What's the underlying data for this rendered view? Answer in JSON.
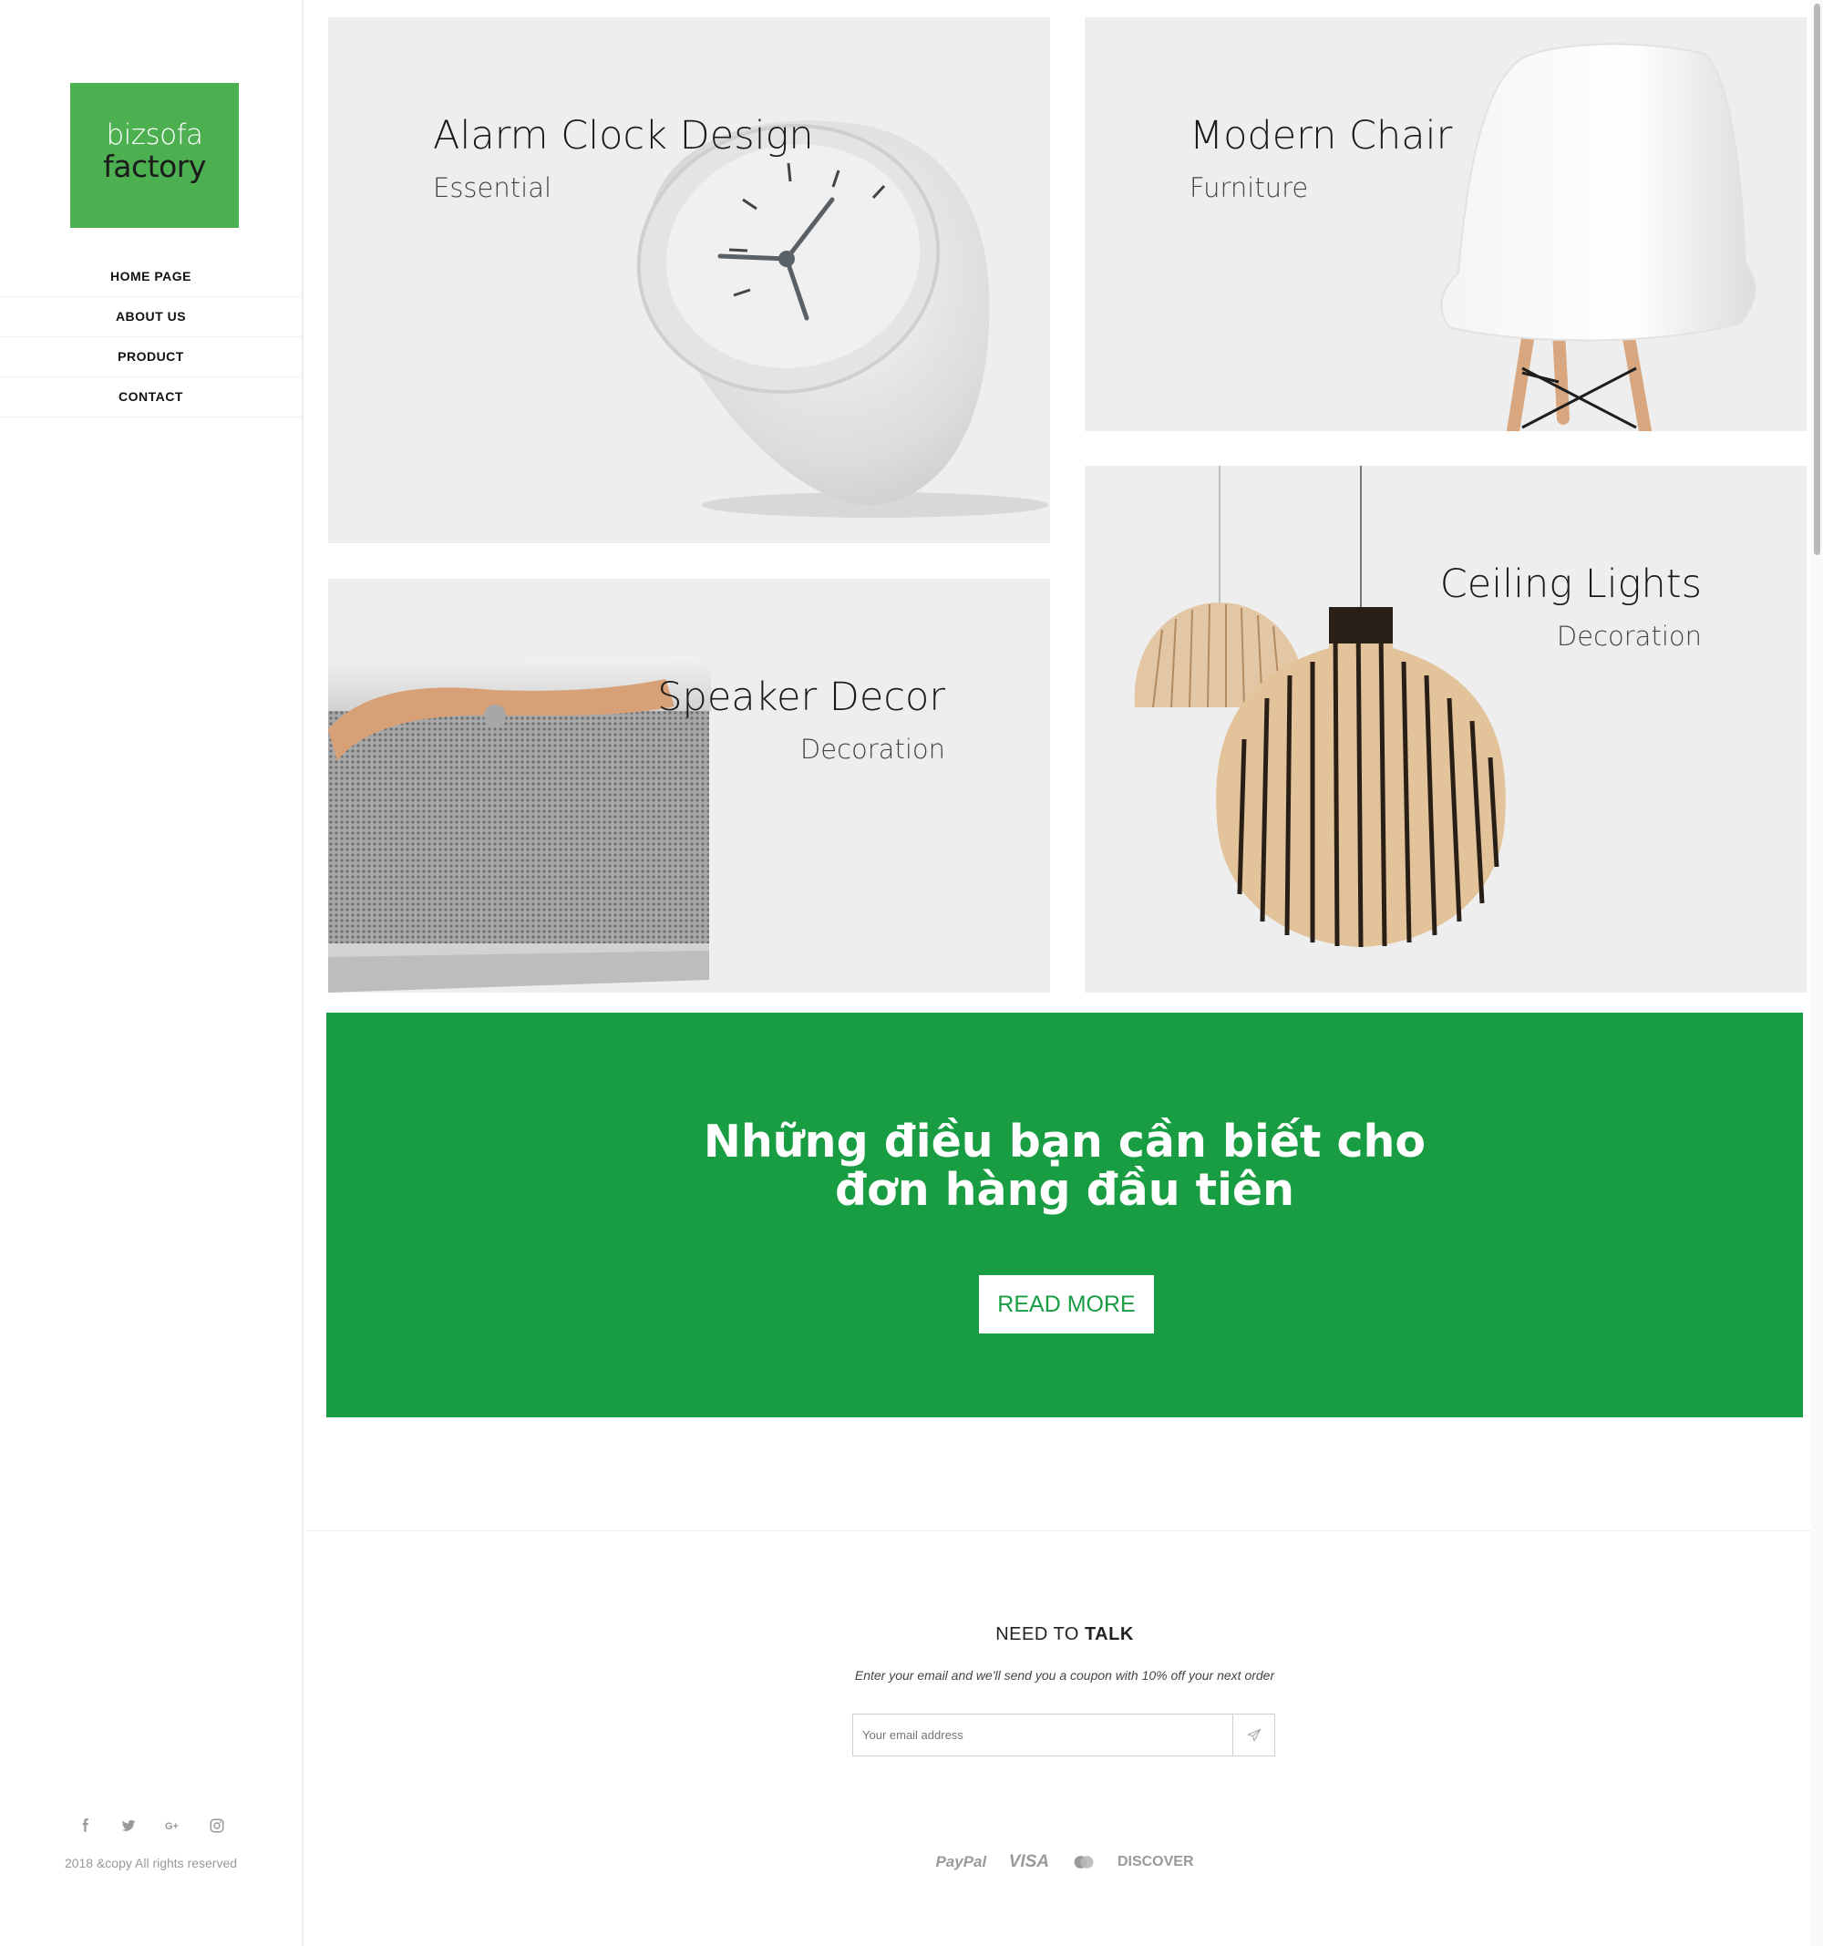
{
  "logo": {
    "line1": "bizsofa",
    "line2": "factory"
  },
  "nav": {
    "items": [
      {
        "label": "HOME PAGE"
      },
      {
        "label": "ABOUT US"
      },
      {
        "label": "PRODUCT"
      },
      {
        "label": "CONTACT"
      }
    ]
  },
  "social": {
    "icons": [
      "facebook-icon",
      "twitter-icon",
      "google-plus-icon",
      "instagram-icon"
    ]
  },
  "footer": {
    "copyright": "2018 &copy All rights reserved"
  },
  "cards": [
    {
      "title": "Alarm Clock Design",
      "subtitle": "Essential"
    },
    {
      "title": "Modern Chair",
      "subtitle": "Furniture"
    },
    {
      "title": "Speaker Decor",
      "subtitle": "Decoration"
    },
    {
      "title": "Ceiling Lights",
      "subtitle": "Decoration"
    }
  ],
  "banner": {
    "line1": "Những điều bạn cần biết cho",
    "line2": "đơn hàng đầu tiên",
    "button": "READ MORE",
    "color": "#189d42"
  },
  "newsletter": {
    "title_normal": "NEED TO",
    "title_bold": "TALK",
    "description": "Enter your email and we'll send you a coupon with 10% off your next order",
    "placeholder": "Your email address"
  },
  "payments": {
    "paypal": "PayPal",
    "visa": "VISA",
    "discover": "DISCOVER"
  },
  "colors": {
    "accent": "#4caf50",
    "banner": "#189d42"
  }
}
